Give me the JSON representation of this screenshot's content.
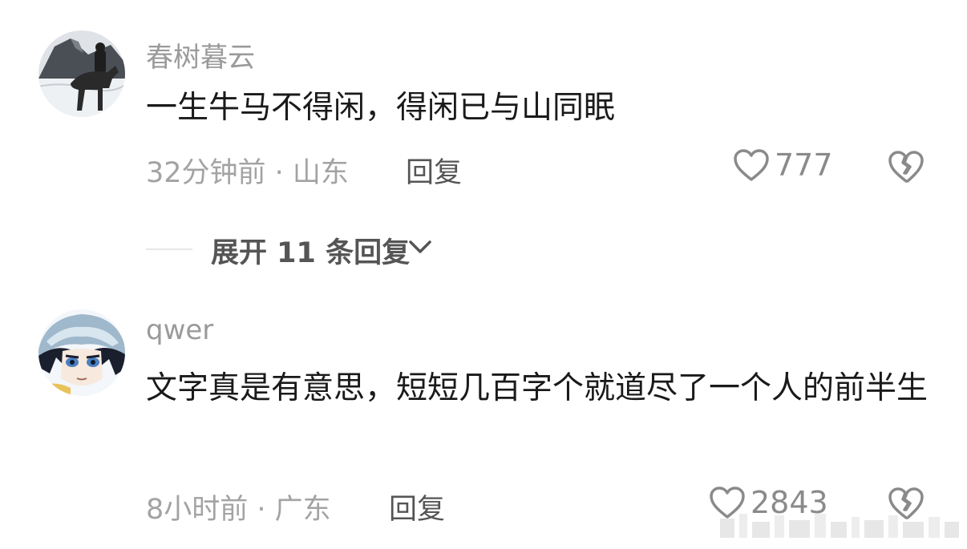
{
  "comments": [
    {
      "username": "春树暮云",
      "text": "一生牛马不得闲，得闲已与山同眠",
      "time_location": "32分钟前 · 山东",
      "reply_label": "回复",
      "like_count": "777",
      "avatar": "horse-rider-avatar"
    },
    {
      "username": "qwer",
      "text": "文字真是有意思，短短几百字个就道尽了一个人的前半生",
      "time_location": "8小时前 · 广东",
      "reply_label": "回复",
      "like_count": "2843",
      "avatar": "anime-character-avatar"
    }
  ],
  "expand_replies": {
    "label": "展开 11 条回复"
  },
  "icons": {
    "like": "heart-outline-icon",
    "dislike": "broken-heart-icon",
    "expand": "chevron-down-icon"
  },
  "colors": {
    "username": "#9a9a9a",
    "text": "#1a1a1a",
    "meta": "#a3a3a3",
    "action": "#555555"
  }
}
